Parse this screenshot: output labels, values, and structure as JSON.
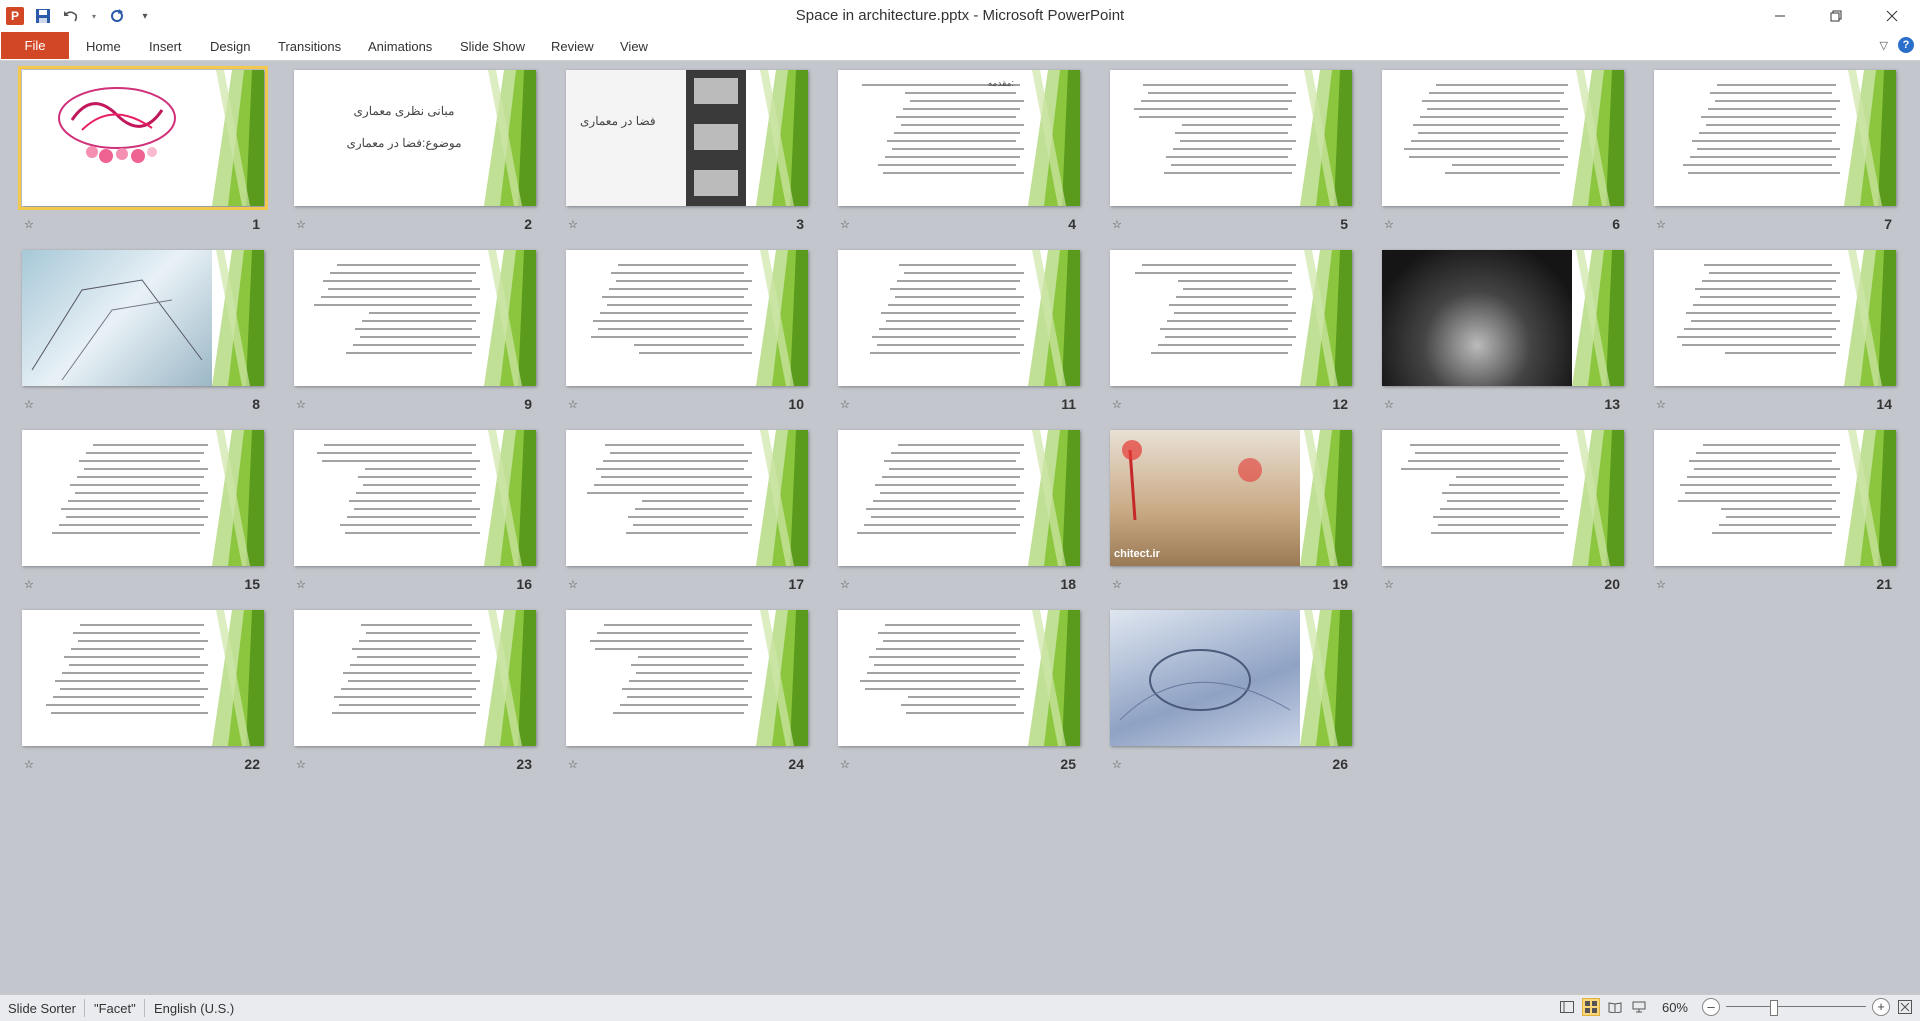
{
  "window": {
    "title": "Space in architecture.pptx - Microsoft PowerPoint",
    "controls": [
      "minimize",
      "restore",
      "close"
    ]
  },
  "quick_access": {
    "app_icon": "powerpoint-icon",
    "app_letter": "P",
    "save": "save-icon",
    "undo": "undo-icon",
    "redo": "redo-icon",
    "customize": "dropdown-icon"
  },
  "ribbon": {
    "file_label": "File",
    "tabs": [
      "Home",
      "Insert",
      "Design",
      "Transitions",
      "Animations",
      "Slide Show",
      "Review",
      "View"
    ],
    "help_label": "?"
  },
  "slides": [
    {
      "number": "1",
      "content": "calligraphy",
      "selected": true
    },
    {
      "number": "2",
      "content": "title",
      "lines": [
        "مبانی نظری معماری",
        "موضوع:فضا در معماری"
      ]
    },
    {
      "number": "3",
      "content": "image-title",
      "lines": [
        "فضا در معماری"
      ]
    },
    {
      "number": "4",
      "content": "text",
      "lines": [
        "مقدمه:"
      ]
    },
    {
      "number": "5",
      "content": "text"
    },
    {
      "number": "6",
      "content": "text"
    },
    {
      "number": "7",
      "content": "text"
    },
    {
      "number": "8",
      "content": "photo-stairs"
    },
    {
      "number": "9",
      "content": "text"
    },
    {
      "number": "10",
      "content": "text"
    },
    {
      "number": "11",
      "content": "text"
    },
    {
      "number": "12",
      "content": "text"
    },
    {
      "number": "13",
      "content": "photo-dark"
    },
    {
      "number": "14",
      "content": "text"
    },
    {
      "number": "15",
      "content": "text"
    },
    {
      "number": "16",
      "content": "text"
    },
    {
      "number": "17",
      "content": "text"
    },
    {
      "number": "18",
      "content": "text"
    },
    {
      "number": "19",
      "content": "photo-interior",
      "lines": [
        "chitect.ir"
      ]
    },
    {
      "number": "20",
      "content": "text"
    },
    {
      "number": "21",
      "content": "text"
    },
    {
      "number": "22",
      "content": "text"
    },
    {
      "number": "23",
      "content": "text"
    },
    {
      "number": "24",
      "content": "text"
    },
    {
      "number": "25",
      "content": "text"
    },
    {
      "number": "26",
      "content": "photo-abstract"
    }
  ],
  "statusbar": {
    "view": "Slide Sorter",
    "theme": "\"Facet\"",
    "language": "English (U.S.)",
    "zoom": "60%",
    "zoom_level_percent": 60
  },
  "colors": {
    "accent": "#d24726",
    "theme_green": "#8cc63f",
    "theme_dark_green": "#5a9a1c",
    "selection": "#f2c94c"
  }
}
